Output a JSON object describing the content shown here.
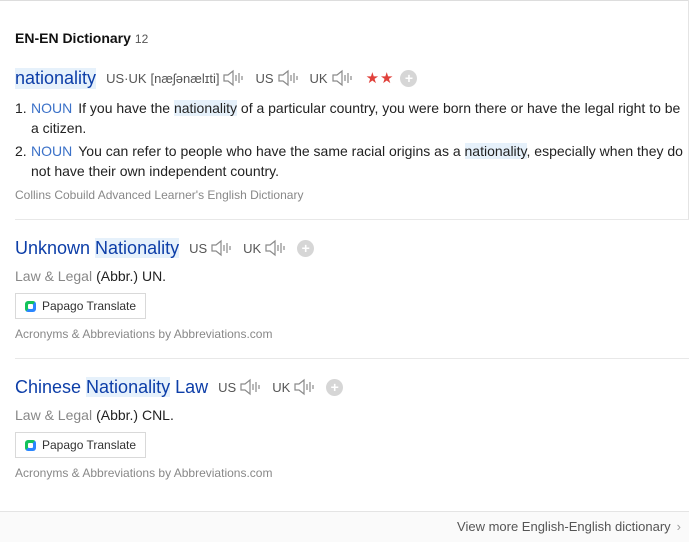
{
  "section": {
    "title": "EN-EN Dictionary",
    "count": "12"
  },
  "entries": [
    {
      "headword": "nationality",
      "pron_us_label": "US·UK",
      "ipa": "[næʃənælɪti]",
      "us_label": "US",
      "uk_label": "UK",
      "stars": "★★",
      "senses": [
        {
          "num": "1.",
          "pos": "NOUN",
          "pre": "If you have the ",
          "hl": "nationality",
          "post": " of a particular country, you were born there or have the legal right to be a citizen."
        },
        {
          "num": "2.",
          "pos": "NOUN",
          "pre": "You can refer to people who have the same racial origins as a ",
          "hl": "nationality",
          "post": ", especially when they do not have their own independent country."
        }
      ],
      "source": "Collins Cobuild Advanced Learner's English Dictionary"
    },
    {
      "headword_pre": "Unknown ",
      "headword_hl": "Nationality",
      "headword_post": "",
      "us_label": "US",
      "uk_label": "UK",
      "field": "Law & Legal",
      "definition": "(Abbr.) UN.",
      "papago": "Papago Translate",
      "source": "Acronyms & Abbreviations by Abbreviations.com"
    },
    {
      "headword_pre": "Chinese ",
      "headword_hl": "Nationality",
      "headword_post": " Law",
      "us_label": "US",
      "uk_label": "UK",
      "field": "Law & Legal",
      "definition": "(Abbr.) CNL.",
      "papago": "Papago Translate",
      "source": "Acronyms & Abbreviations by Abbreviations.com"
    }
  ],
  "footer": {
    "more_label": "View more English-English dictionary"
  },
  "icons": {
    "speaker": "speaker-icon",
    "plus": "plus-icon",
    "chevron": "chevron-right-icon",
    "papago": "papago-logo-icon"
  },
  "colors": {
    "headword": "#0d3ea8",
    "pos": "#3b71c8",
    "stars": "#e0413b",
    "highlight": "#e6f1fb"
  }
}
